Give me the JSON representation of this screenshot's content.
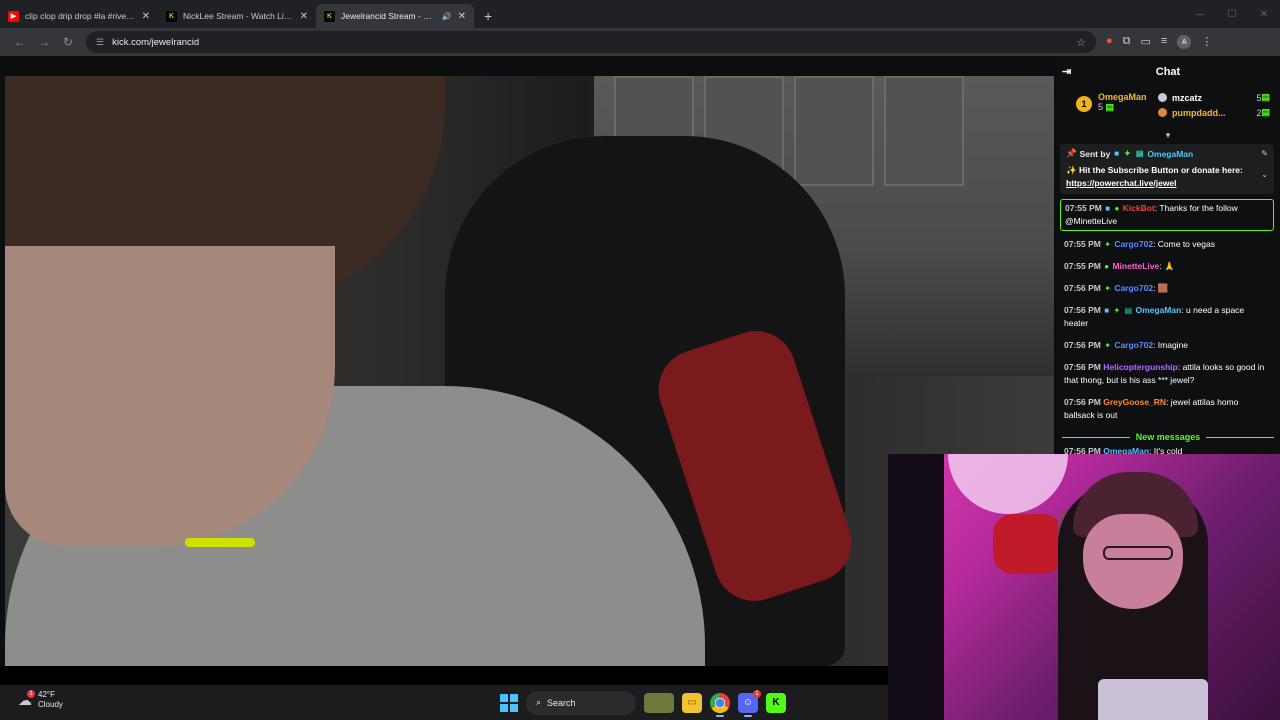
{
  "browser": {
    "tabs": [
      {
        "title": "clip clop drip drop #la #riversid",
        "favicon": "youtube-icon",
        "active": false
      },
      {
        "title": "NickLee Stream - Watch Live on",
        "favicon": "kick-icon",
        "active": false
      },
      {
        "title": "Jewelrancid Stream - Watch",
        "favicon": "kick-icon",
        "active": true,
        "audio": true
      }
    ],
    "new_tab": "+",
    "url": "kick.com/jewelrancid",
    "profile_initial": "A"
  },
  "chat": {
    "title": "Chat",
    "leaderboard": {
      "top": {
        "rank": "1",
        "name": "OmegaMan",
        "count": "5"
      },
      "others": [
        {
          "name": "mzcatz",
          "count": "5",
          "color": "#ffffff"
        },
        {
          "name": "pumpdadd...",
          "count": "2",
          "color": "#f5b829"
        }
      ]
    },
    "pinned": {
      "sent_by_label": "Sent by",
      "sent_by_user": "OmegaMan",
      "message_prefix": "✨ Hit the Subscribe Button or donate here: ",
      "link": "https://powerchat.live/jewel"
    },
    "messages": [
      {
        "time": "07:55 PM",
        "user": "KickBot",
        "color": "#ff3b3b",
        "text": ": Thanks for the follow @MinetteLive",
        "highlight": true
      },
      {
        "time": "07:55 PM",
        "user": "Cargo702",
        "color": "#5b8cff",
        "text": ": Come to vegas",
        "highlight": false
      },
      {
        "time": "07:55 PM",
        "user": "MinetteLive",
        "color": "#ff5fd2",
        "text": ": 🙏",
        "highlight": false
      },
      {
        "time": "07:56 PM",
        "user": "Cargo702",
        "color": "#5b8cff",
        "text": ": 🟫",
        "highlight": false
      },
      {
        "time": "07:56 PM",
        "user": "OmegaMan",
        "color": "#53c6fc",
        "text": ": u need a space heater",
        "highlight": false
      },
      {
        "time": "07:56 PM",
        "user": "Cargo702",
        "color": "#5b8cff",
        "text": ": Imagine",
        "highlight": false
      },
      {
        "time": "07:56 PM",
        "user": "Helicoptergunship",
        "color": "#b26bff",
        "text": ": attila looks so good in that thong, but is his ass *** jewel?",
        "highlight": false
      },
      {
        "time": "07:56 PM",
        "user": "GreyGoose_RN",
        "color": "#ff8c2b",
        "text": ": jewel attilas homo ballsack is out",
        "highlight": false
      }
    ],
    "new_messages_label": "New messages",
    "cut_message": {
      "time": "07:56 PM",
      "user": "OmegaMan",
      "text": ": It's cold"
    }
  },
  "taskbar": {
    "weather": {
      "temp": "42°F",
      "condition": "Cloudy",
      "alert_count": "1"
    },
    "search_label": "Search",
    "apps": [
      "widgets",
      "file-explorer",
      "chrome",
      "discord",
      "kick"
    ],
    "discord_badge": "1"
  }
}
